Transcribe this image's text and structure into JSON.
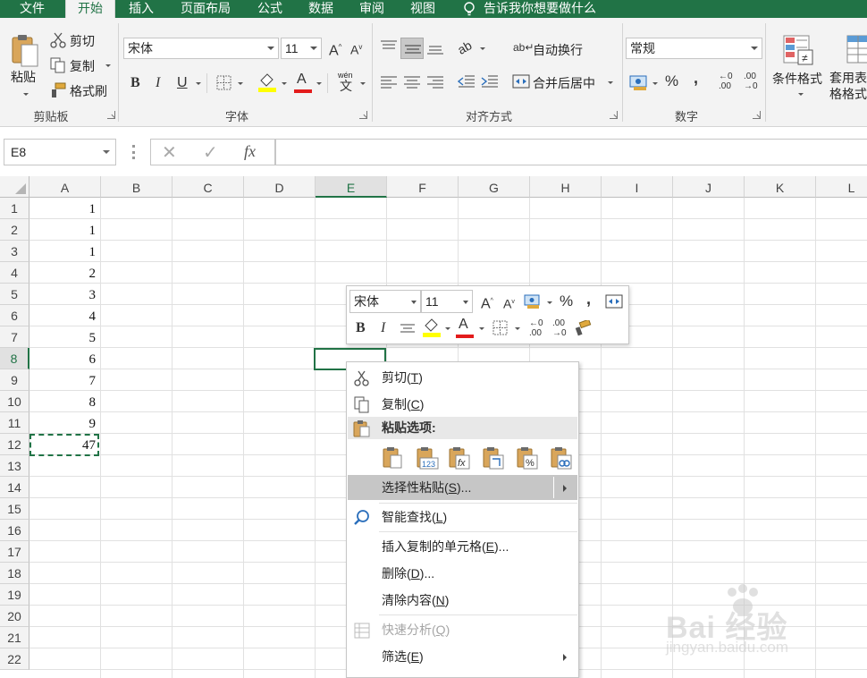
{
  "tabs": [
    "文件",
    "开始",
    "插入",
    "页面布局",
    "公式",
    "数据",
    "审阅",
    "视图"
  ],
  "active_tab": "开始",
  "tell_me": "告诉我你想要做什么",
  "ribbon": {
    "clipboard": {
      "paste": "粘贴",
      "cut": "剪切",
      "copy": "复制",
      "format_painter": "格式刷",
      "label": "剪贴板"
    },
    "font": {
      "name": "宋体",
      "size": "11",
      "label": "字体",
      "phonetic": "wén"
    },
    "alignment": {
      "wrap": "自动换行",
      "merge": "合并后居中",
      "label": "对齐方式"
    },
    "number": {
      "format": "常规",
      "percent": "%",
      "comma": ",",
      "label": "数字"
    },
    "styles": {
      "conditional": "条件格式",
      "table": "套用表格格式"
    }
  },
  "formula_bar": {
    "name_box": "E8",
    "fx": "fx",
    "cancel": "✕",
    "enter": "✓",
    "value": ""
  },
  "columns": [
    "A",
    "B",
    "C",
    "D",
    "E",
    "F",
    "G",
    "H",
    "I",
    "J",
    "K",
    "L"
  ],
  "selected_column": "E",
  "rows": [
    "1",
    "2",
    "3",
    "4",
    "5",
    "6",
    "7",
    "8",
    "9",
    "10",
    "11",
    "12",
    "13",
    "14",
    "15",
    "16",
    "17",
    "18",
    "19",
    "20",
    "21",
    "22"
  ],
  "selected_row": "8",
  "column_a_values": [
    "1",
    "1",
    "1",
    "2",
    "3",
    "4",
    "5",
    "6",
    "7",
    "8",
    "9",
    "47"
  ],
  "mini_toolbar": {
    "font": "宋体",
    "size": "11",
    "percent": "%",
    "comma": ","
  },
  "context_menu": {
    "cut": {
      "text": "剪切(",
      "key": "T",
      "end": ")"
    },
    "copy": {
      "text": "复制(",
      "key": "C",
      "end": ")"
    },
    "paste_options": "粘贴选项:",
    "paste_special": {
      "text": "选择性粘贴(",
      "key": "S",
      "end": ")..."
    },
    "smart_lookup": {
      "text": "智能查找(",
      "key": "L",
      "end": ")"
    },
    "insert_copied": {
      "text": "插入复制的单元格(",
      "key": "E",
      "end": ")..."
    },
    "delete": {
      "text": "删除(",
      "key": "D",
      "end": ")..."
    },
    "clear": {
      "text": "清除内容(",
      "key": "N",
      "end": ")"
    },
    "quick_analysis": {
      "text": "快速分析(",
      "key": "Q",
      "end": ")"
    },
    "filter": {
      "text": "筛选(",
      "key": "E",
      "end": ")"
    }
  },
  "watermark": {
    "brand": "Bai 经验",
    "url": "jingyan.baidu.com"
  },
  "colors": {
    "accent": "#217346",
    "ribbon_bg": "#f3f3f3",
    "highlight": "#c6c6c6"
  }
}
